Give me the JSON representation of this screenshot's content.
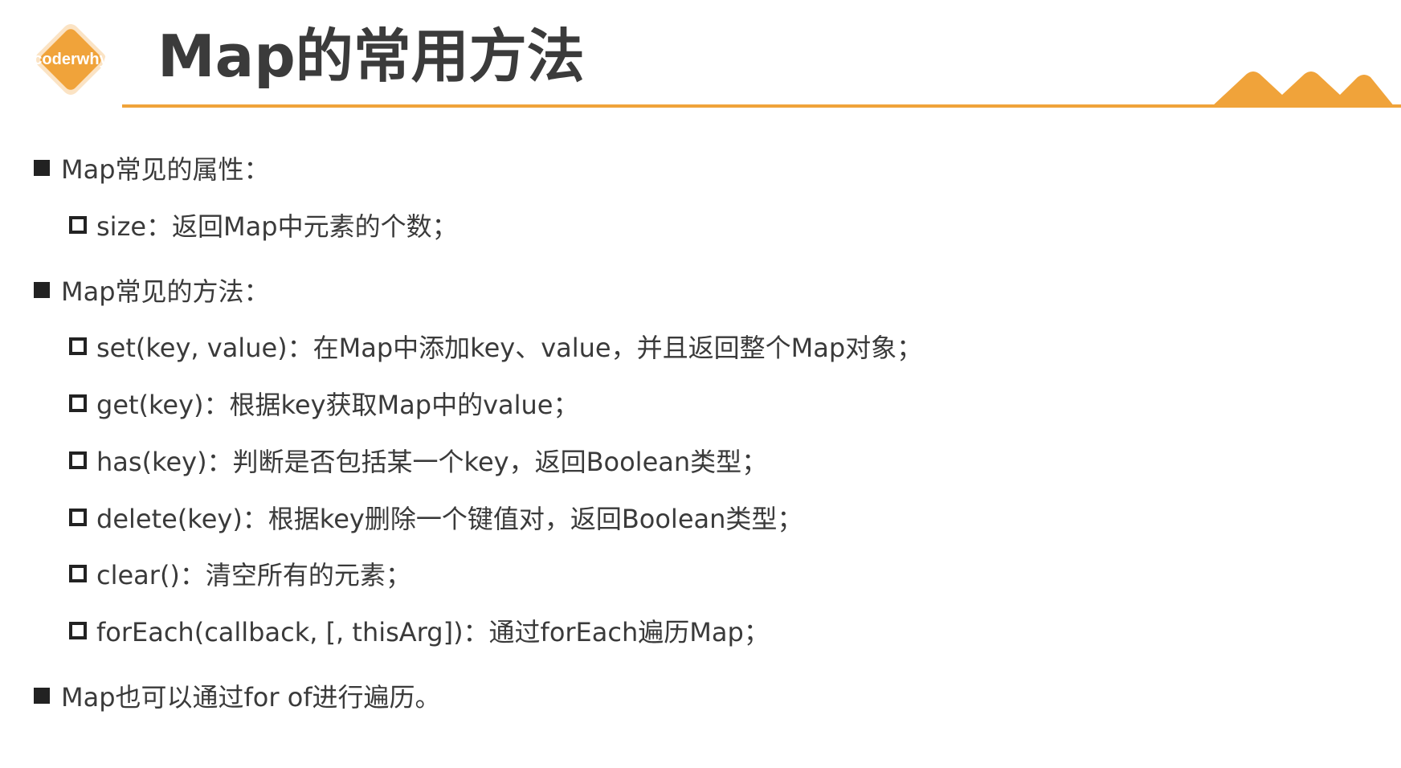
{
  "logo": {
    "text": "coderwhy",
    "colors": {
      "diamond": "#F0A33A",
      "outline": "#FBE3C4",
      "text": "#FFFFFF"
    }
  },
  "header": {
    "title": "Map的常用方法",
    "accent_color": "#F0A33A"
  },
  "sections": [
    {
      "heading": "Map常见的属性：",
      "items": [
        {
          "text": "size：返回Map中元素的个数；"
        }
      ]
    },
    {
      "heading": "Map常见的方法：",
      "items": [
        {
          "text": "set(key, value)：在Map中添加key、value，并且返回整个Map对象；"
        },
        {
          "text": "get(key)：根据key获取Map中的value；"
        },
        {
          "text": "has(key)：判断是否包括某一个key，返回Boolean类型；"
        },
        {
          "text": "delete(key)：根据key删除一个键值对，返回Boolean类型；"
        },
        {
          "text": "clear()：清空所有的元素；"
        },
        {
          "text": "forEach(callback, [, thisArg])：通过forEach遍历Map；"
        }
      ]
    },
    {
      "heading": "Map也可以通过for of进行遍历。",
      "items": []
    }
  ],
  "icons": {
    "level1_bullet": "filled-square-icon",
    "level2_bullet": "hollow-square-icon"
  }
}
